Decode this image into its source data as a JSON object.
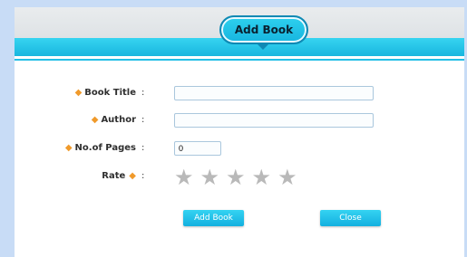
{
  "dialog": {
    "title": "Add Book"
  },
  "form": {
    "book_title": {
      "label": "Book Title",
      "value": ""
    },
    "author": {
      "label": "Author",
      "value": ""
    },
    "pages": {
      "label": "No.of Pages",
      "value": "0"
    },
    "rate": {
      "label": "Rate",
      "stars_total": 5,
      "stars_selected": 0
    },
    "colon": ":",
    "required_marker": "◆"
  },
  "buttons": {
    "add_label": "Add Book",
    "close_label": "Close"
  },
  "colors": {
    "accent": "#1cbbe3",
    "required": "#f09a2b",
    "background": "#c8dcf6"
  },
  "icons": {
    "star": "star-icon",
    "required": "diamond-icon"
  }
}
